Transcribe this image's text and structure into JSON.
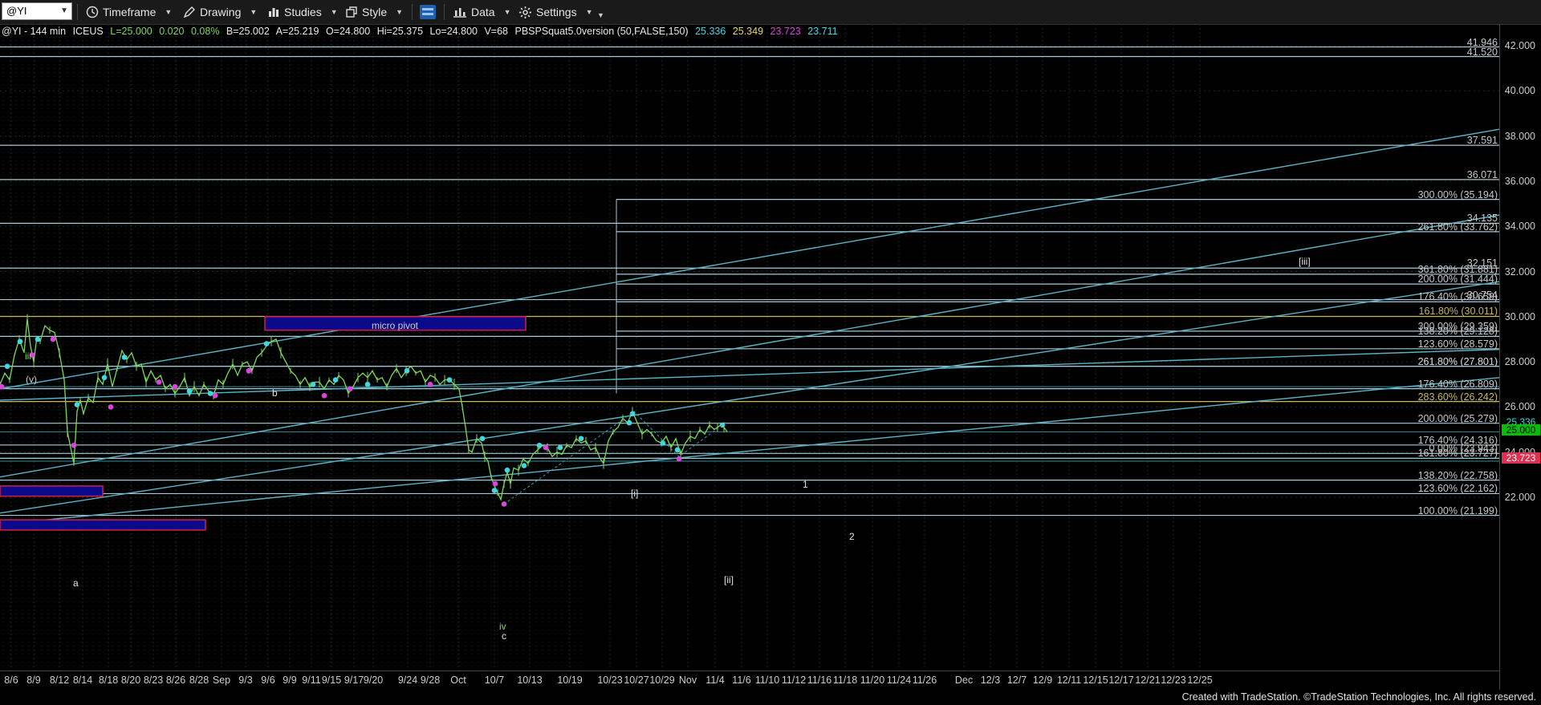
{
  "toolbar": {
    "symbol": "@YI",
    "timeframe_label": "Timeframe",
    "drawing_label": "Drawing",
    "studies_label": "Studies",
    "style_label": "Style",
    "data_label": "Data",
    "settings_label": "Settings"
  },
  "info": {
    "symbol": "@YI - 144 min",
    "exchange": "ICEUS",
    "last": "L=25.000",
    "change": "0.020",
    "change_pct": "0.08%",
    "bid": "B=25.002",
    "ask": "A=25.219",
    "open": "O=24.800",
    "high": "Hi=25.375",
    "low": "Lo=24.800",
    "volume": "V=68",
    "study": "PBSPSquat5.0version (50,FALSE,150)",
    "study_v1": "25.336",
    "study_v2": "25.349",
    "study_v3": "23.723",
    "study_v4": "23.711"
  },
  "colors": {
    "background": "#000000",
    "price_line": "#7ed957",
    "fib_line": "#a8c8d8",
    "gold_line": "#c8b860",
    "channel": "#5ab4c8",
    "magenta": "#e040e0",
    "cyan": "#40d8e0",
    "green_box": "#00c000",
    "red_box": "#e03050",
    "pivot_fill": "#0a0a8a",
    "pivot_border": "#d0204a"
  },
  "price_axis": {
    "ticks": [
      "42.000",
      "40.000",
      "38.000",
      "36.000",
      "34.000",
      "32.000",
      "30.000",
      "28.000",
      "26.000",
      "24.000",
      "22.000"
    ],
    "last_price": "25.336",
    "current_price": "25.000",
    "low_marker": "23.723"
  },
  "date_axis": {
    "labels": [
      "8/6",
      "8/9",
      "8/12",
      "8/14",
      "8/18",
      "8/20",
      "8/23",
      "8/26",
      "8/28",
      "Sep",
      "9/3",
      "9/6",
      "9/9",
      "9/11",
      "9/15",
      "9/17",
      "9/20",
      "9/24",
      "9/28",
      "Oct",
      "10/7",
      "10/13",
      "10/19",
      "10/23",
      "10/27",
      "10/29",
      "Nov",
      "11/4",
      "11/6",
      "11/10",
      "11/12",
      "11/16",
      "11/18",
      "11/20",
      "11/24",
      "11/26",
      "Dec",
      "12/3",
      "12/7",
      "12/9",
      "12/11",
      "12/15",
      "12/17",
      "12/21",
      "12/23",
      "12/25"
    ]
  },
  "levels": [
    {
      "label": "41.946"
    },
    {
      "label": "41.520"
    },
    {
      "label": "37.591"
    },
    {
      "label": "36.071"
    },
    {
      "label": "300.00% (35.194)"
    },
    {
      "label": "34.135"
    },
    {
      "label": "261.80% (33.762)"
    },
    {
      "label": "32.151"
    },
    {
      "label": "361.80% (31.881)"
    },
    {
      "label": "200.00% (31.444)"
    },
    {
      "label": "30.754"
    },
    {
      "label": "176.40% (30.659)"
    },
    {
      "label": "161.80% (30.011)"
    },
    {
      "label": "300.00% (29.359)"
    },
    {
      "label": "138.20% (29.128)"
    },
    {
      "label": "123.60% (28.579)"
    },
    {
      "label": "261.80% (27.801)"
    },
    {
      "label": "261.80% (27.801)"
    },
    {
      "label": "176.40% (26.809)"
    },
    {
      "label": "283.60% (26.242)"
    },
    {
      "label": "200.00% (25.279)"
    },
    {
      "label": "176.40% (24.316)"
    },
    {
      "label": "0.00% (23.943)"
    },
    {
      "label": "161.80% (23.727)"
    },
    {
      "label": "138.20% (22.758)"
    },
    {
      "label": "123.60% (22.162)"
    },
    {
      "label": "100.00% (21.199)"
    }
  ],
  "waves": {
    "iii_green": "iii",
    "v_paren": "(v)",
    "a": "a",
    "b": "b",
    "c": "c",
    "iv_green": "iv",
    "i_bracket": "[i]",
    "ii_bracket": "[ii]",
    "iii_bracket": "[iii]",
    "one": "1",
    "two": "2"
  },
  "pivot": {
    "label": "micro pivot"
  },
  "footer": "Created with TradeStation. ©TradeStation Technologies, Inc. All rights reserved."
}
